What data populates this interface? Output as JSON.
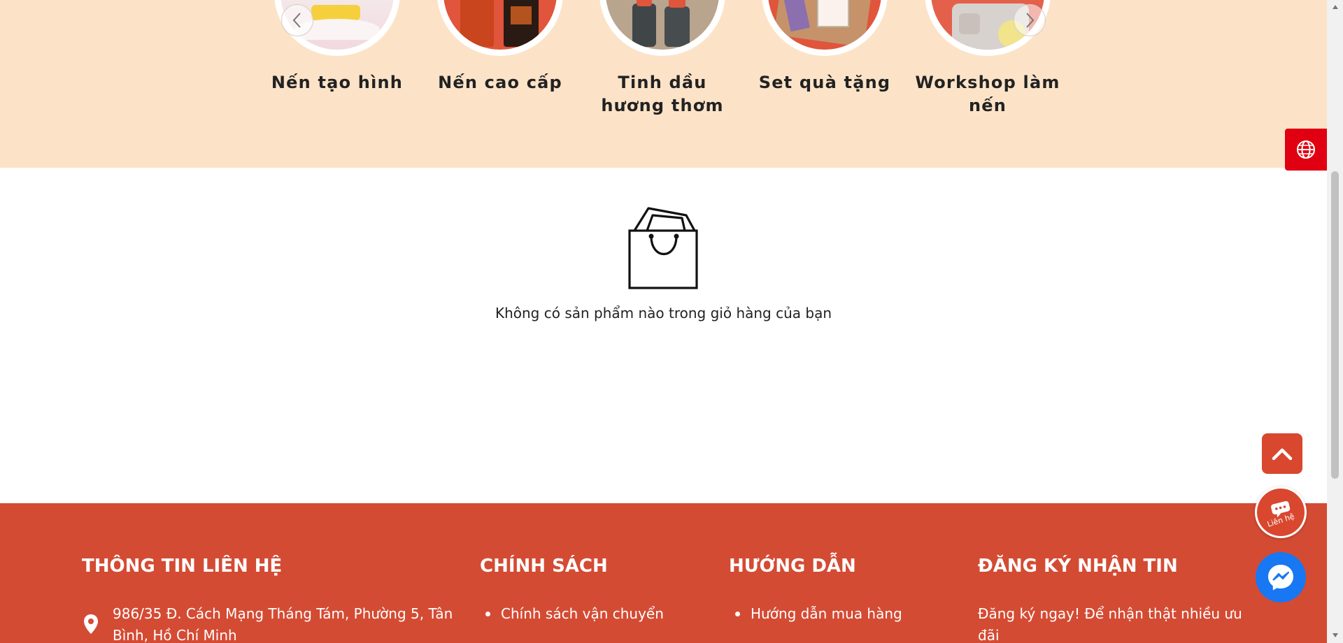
{
  "categories": [
    {
      "label": "Nến tạo hình",
      "image_icon": "shaped-candle-image"
    },
    {
      "label": "Nến cao cấp",
      "image_icon": "premium-candle-image"
    },
    {
      "label": "Tinh dầu hương thơm",
      "image_icon": "essential-oil-image"
    },
    {
      "label": "Set quà tặng",
      "image_icon": "gift-set-image"
    },
    {
      "label": "Workshop làm nến",
      "image_icon": "candle-workshop-image"
    }
  ],
  "cart": {
    "empty_message": "Không có sản phẩm nào trong giỏ hàng của bạn",
    "icon": "shopping-bag-icon"
  },
  "footer": {
    "contact": {
      "title": "THÔNG TIN LIÊN HỆ",
      "address_line1": "986/35 Đ. Cách Mạng Tháng Tám, Phường 5, Tân",
      "address_line2": "Bình, Hồ Chí Minh"
    },
    "policy": {
      "title": "CHÍNH SÁCH",
      "items": [
        "Chính sách vận chuyển"
      ]
    },
    "guide": {
      "title": "HƯỚNG DẪN",
      "items": [
        "Hướng dẫn mua hàng"
      ]
    },
    "newsletter": {
      "title": "ĐĂNG KÝ NHẬN TIN",
      "text_line1": "Đăng ký ngay! Để nhận thật nhiều ưu",
      "text_line2": "đãi"
    }
  },
  "floating": {
    "contact_label": "Liên hệ"
  },
  "colors": {
    "category_band": "#fce3c8",
    "footer_bg": "#d44b33",
    "accent_red": "#d9472f",
    "language_button": "#e00012",
    "messenger_blue": "#1877f2"
  }
}
